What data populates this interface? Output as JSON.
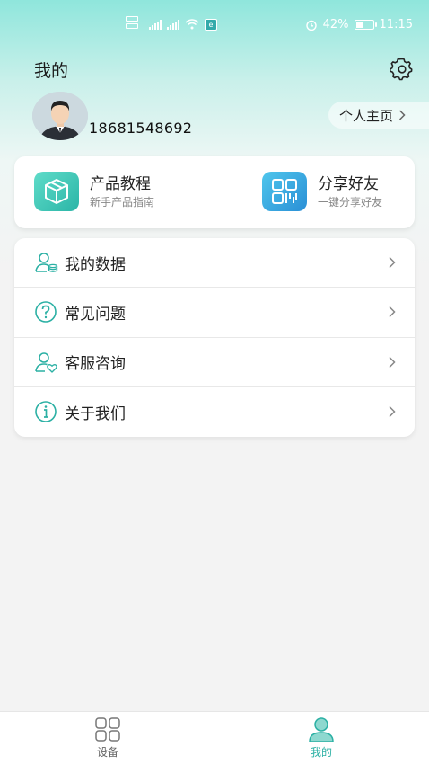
{
  "status_bar": {
    "battery": "42%",
    "time": "11:15",
    "battery_level": 0.42
  },
  "header": {
    "title": "我的"
  },
  "profile": {
    "phone": "18681548692",
    "homepage_label": "个人主页"
  },
  "features": [
    {
      "title": "产品教程",
      "subtitle": "新手产品指南",
      "icon": "box-icon"
    },
    {
      "title": "分享好友",
      "subtitle": "一键分享好友",
      "icon": "qr-code-icon"
    }
  ],
  "menu": [
    {
      "label": "我的数据",
      "icon": "user-data-icon"
    },
    {
      "label": "常见问题",
      "icon": "question-icon"
    },
    {
      "label": "客服咨询",
      "icon": "customer-service-icon"
    },
    {
      "label": "关于我们",
      "icon": "info-icon"
    }
  ],
  "bottom_nav": [
    {
      "label": "设备",
      "icon": "grid-icon",
      "active": false
    },
    {
      "label": "我的",
      "icon": "person-icon",
      "active": true
    }
  ],
  "colors": {
    "accent": "#2bb0a4",
    "gradient_top": "#8fe6dc"
  }
}
